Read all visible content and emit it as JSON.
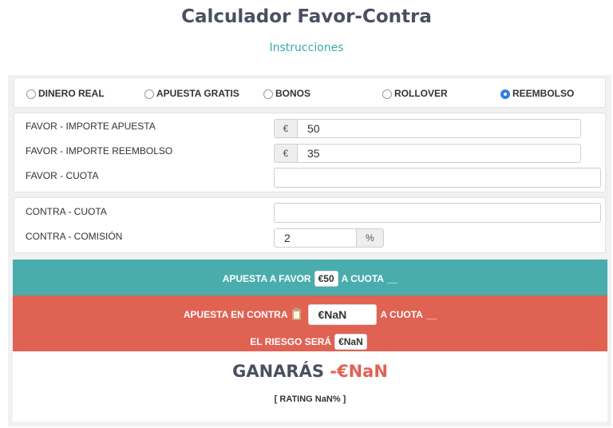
{
  "header": {
    "title": "Calculador Favor-Contra",
    "instructions_link": "Instrucciones"
  },
  "mode_options": [
    {
      "label": "DINERO REAL",
      "checked": false
    },
    {
      "label": "APUESTA GRATIS",
      "checked": false
    },
    {
      "label": "BONOS",
      "checked": false
    },
    {
      "label": "ROLLOVER",
      "checked": false
    },
    {
      "label": "REEMBOLSO",
      "checked": true
    }
  ],
  "favor": {
    "importe_label": "FAVOR - IMPORTE APUESTA",
    "importe_currency": "€",
    "importe_value": "50",
    "reembolso_label": "FAVOR - IMPORTE REEMBOLSO",
    "reembolso_currency": "€",
    "reembolso_value": "35",
    "cuota_label": "FAVOR - CUOTA",
    "cuota_value": ""
  },
  "contra": {
    "cuota_label": "CONTRA - CUOTA",
    "cuota_value": "",
    "comision_label": "CONTRA - COMISIÓN",
    "comision_value": "2",
    "comision_unit": "%"
  },
  "summary": {
    "favor_prefix": "APUESTA A FAVOR",
    "favor_amount": "€50",
    "favor_cuota_text": "A CUOTA",
    "favor_cuota_value": "__",
    "contra_prefix": "APUESTA EN CONTRA",
    "contra_amount": "€NaN",
    "contra_cuota_text": "A CUOTA",
    "contra_cuota_value": "__",
    "riesgo_label": "EL RIESGO SERÁ",
    "riesgo_value": "€NaN"
  },
  "result": {
    "ganaras_label": "GANARÁS",
    "ganaras_value": "-€NaN",
    "rating_text": "[ RATING NaN% ]"
  },
  "colors": {
    "teal": "#4aadad",
    "red": "#e06253",
    "title": "#4a5061",
    "radio_checked": "#2f7fe8"
  },
  "icons": {
    "copy": "clipboard-icon"
  }
}
